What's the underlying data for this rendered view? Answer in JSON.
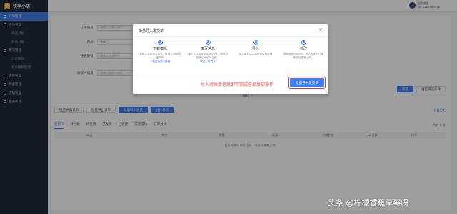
{
  "app": {
    "title": "快手小店",
    "logo_char": "快"
  },
  "sidebar": {
    "items": [
      {
        "label": "订单管理",
        "active": true
      },
      {
        "label": "商品管理"
      },
      {
        "label": "商品列表"
      },
      {
        "label": "商品分类"
      },
      {
        "label": "物流管理"
      },
      {
        "label": "运费模板"
      },
      {
        "label": "发货模板管理"
      },
      {
        "label": "售后管理"
      },
      {
        "label": "资金管理"
      },
      {
        "label": "店铺管理"
      },
      {
        "label": "服务市场"
      }
    ]
  },
  "topbar": {
    "user_name": "蓝刊先生",
    "user_id": "ID: 1489465175"
  },
  "filters": [
    {
      "label": "订单编号:",
      "placeholder": "请输入订单订单号"
    },
    {
      "label": "商品:",
      "placeholder": "全部"
    },
    {
      "label": "快递单号:",
      "placeholder": "请输入快递单号"
    },
    {
      "label": "收货人信息:",
      "placeholder": "请输入收货人信息"
    }
  ],
  "buttons": {
    "search": "筛选",
    "clear": "清空筛选条件",
    "collapse": "收起 ^"
  },
  "actions": [
    "批量导出订单",
    "批量导出订单",
    "批量导入发货",
    "合并发货"
  ],
  "action_right": "查看历史",
  "tabs": [
    "全部 0",
    "待付款",
    "待发货",
    "已发货",
    "已收货",
    "交易成功",
    "订单关闭"
  ],
  "total": "共计 0 条",
  "table_headers": [
    "商品",
    "单价",
    "数量",
    "买家",
    "订单状态",
    "实付款",
    "操作"
  ],
  "empty_text": "暂无符合条件的订单，请尝试其他条件",
  "modal": {
    "title": "批量导入发货单",
    "close": "×",
    "steps": [
      {
        "title": "下载模版",
        "desc": "按填方式包括订单号、快递公司和快递单号",
        "link": "下载批量导入模版"
      },
      {
        "title": "填写信息",
        "desc": "每个文件最多支持5000条，请务必快递公司填写正确。",
        "link": "快递公司列表"
      },
      {
        "title": "导入",
        "desc": "多次覆盖导入将覆盖原有数据"
      },
      {
        "title": "修改",
        "desc": "参考返回Excel表，导入失败的订单修改后重新上传。"
      }
    ],
    "annotation": "导入对账单信息即可完成全部发货操作",
    "import_button": "批量导入发货单"
  },
  "watermark": "头条 @柠檬香蕉草莓呀"
}
